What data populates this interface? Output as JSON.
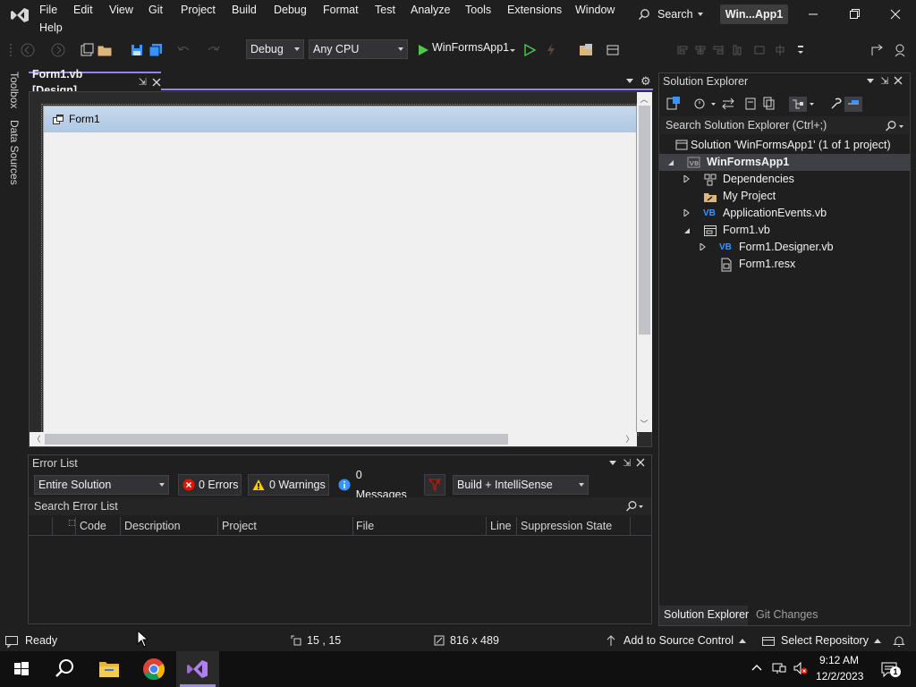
{
  "menu": {
    "items": [
      "File",
      "Edit",
      "View",
      "Git",
      "Project",
      "Build",
      "Debug",
      "Format",
      "Test",
      "Analyze",
      "Tools",
      "Extensions",
      "Window",
      "Help"
    ],
    "search_label": "Search",
    "solution_badge": "Win...App1"
  },
  "toolbar": {
    "config": "Debug",
    "platform": "Any CPU",
    "run_target": "WinFormsApp1"
  },
  "left_tabs": [
    "Toolbox",
    "Data Sources"
  ],
  "document": {
    "tab_label": "Form1.vb [Design]",
    "form_title": "Form1"
  },
  "error_list": {
    "title": "Error List",
    "scope": "Entire Solution",
    "errors": "0 Errors",
    "warnings": "0 Warnings",
    "messages": "0 Messages",
    "source": "Build + IntelliSense",
    "search_placeholder": "Search Error List",
    "columns": [
      "Code",
      "Description",
      "Project",
      "File",
      "Line",
      "Suppression State"
    ]
  },
  "solution_explorer": {
    "title": "Solution Explorer",
    "search_placeholder": "Search Solution Explorer (Ctrl+;)",
    "tree": [
      {
        "label": "Solution 'WinFormsApp1' (1 of 1 project)",
        "icon": "solution-icon"
      },
      {
        "label": "WinFormsApp1",
        "icon": "vb-project-icon"
      },
      {
        "label": "Dependencies",
        "icon": "dependencies-icon"
      },
      {
        "label": "My Project",
        "icon": "folder-wrench-icon"
      },
      {
        "label": "ApplicationEvents.vb",
        "icon": "vb-file-icon"
      },
      {
        "label": "Form1.vb",
        "icon": "form-icon"
      },
      {
        "label": "Form1.Designer.vb",
        "icon": "vb-file-icon"
      },
      {
        "label": "Form1.resx",
        "icon": "resx-icon"
      }
    ],
    "tabs": [
      "Solution Explorer",
      "Git Changes"
    ]
  },
  "statusbar": {
    "ready": "Ready",
    "position": "15 , 15",
    "size": "816 x 489",
    "source_control": "Add to Source Control",
    "repository": "Select Repository"
  },
  "taskbar": {
    "time": "9:12 AM",
    "date": "12/2/2023",
    "notification_count": "1"
  },
  "colors": {
    "accent": "#9184ee",
    "background": "#1f1f1f",
    "error_red": "#e51400",
    "warning_yellow": "#ffcc00",
    "info_blue": "#3794ff"
  }
}
